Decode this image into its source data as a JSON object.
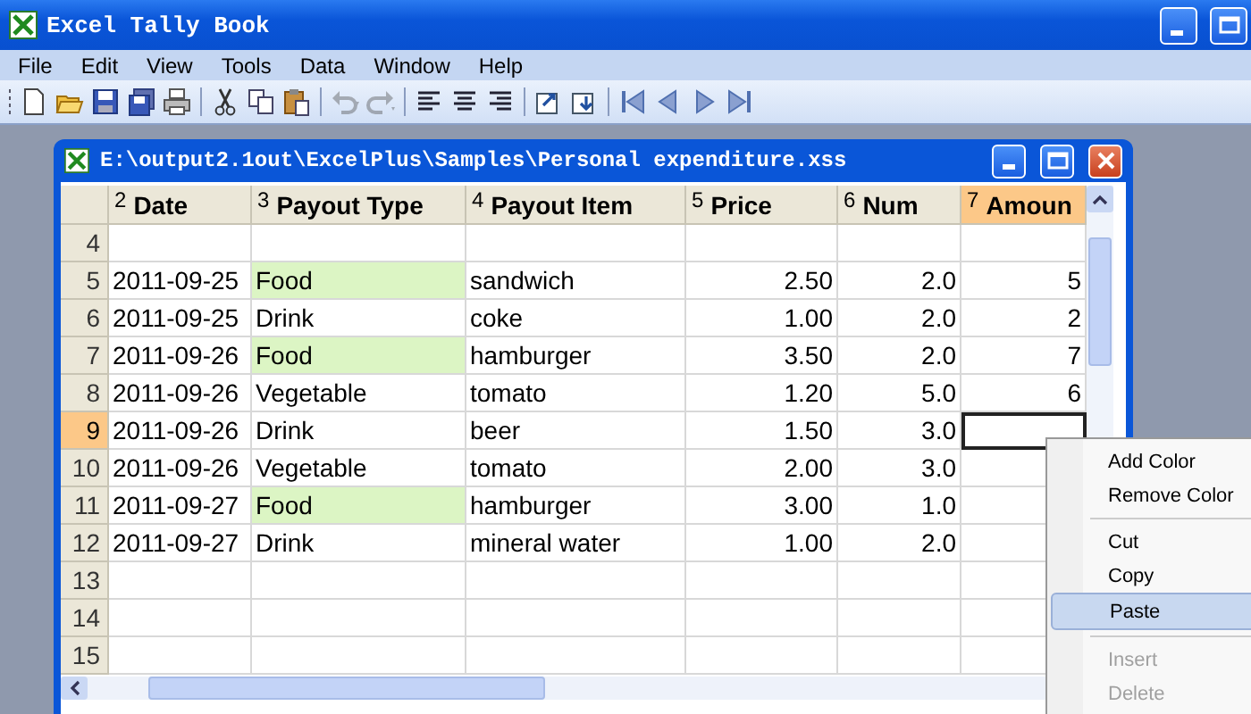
{
  "app": {
    "title": "Excel Tally Book"
  },
  "menu": [
    "File",
    "Edit",
    "View",
    "Tools",
    "Data",
    "Window",
    "Help"
  ],
  "toolbar": [
    {
      "kind": "new",
      "disabled": false
    },
    {
      "kind": "open",
      "disabled": false
    },
    {
      "kind": "save",
      "disabled": false
    },
    {
      "kind": "saveall",
      "disabled": false
    },
    {
      "kind": "print",
      "disabled": false
    },
    {
      "kind": "separator",
      "disabled": false
    },
    {
      "kind": "cut",
      "disabled": false
    },
    {
      "kind": "copy",
      "disabled": false
    },
    {
      "kind": "paste",
      "disabled": false
    },
    {
      "kind": "separator",
      "disabled": false
    },
    {
      "kind": "undo",
      "disabled": true
    },
    {
      "kind": "redo",
      "disabled": true
    },
    {
      "kind": "separator",
      "disabled": false
    },
    {
      "kind": "alignleft",
      "disabled": false
    },
    {
      "kind": "aligncenter",
      "disabled": false
    },
    {
      "kind": "alignright",
      "disabled": false
    },
    {
      "kind": "separator",
      "disabled": false
    },
    {
      "kind": "export",
      "disabled": false
    },
    {
      "kind": "import",
      "disabled": false
    },
    {
      "kind": "separator",
      "disabled": false
    },
    {
      "kind": "first",
      "disabled": false
    },
    {
      "kind": "prev",
      "disabled": false
    },
    {
      "kind": "next",
      "disabled": false
    },
    {
      "kind": "last",
      "disabled": false
    }
  ],
  "document": {
    "title": "E:\\output2.1out\\ExcelPlus\\Samples\\Personal expenditure.xss",
    "columns": [
      {
        "number": "2",
        "label": "Date",
        "selected": false
      },
      {
        "number": "3",
        "label": "Payout Type",
        "selected": false
      },
      {
        "number": "4",
        "label": "Payout Item",
        "selected": false
      },
      {
        "number": "5",
        "label": "Price",
        "selected": false
      },
      {
        "number": "6",
        "label": "Num",
        "selected": false
      },
      {
        "number": "7",
        "label": "Amoun",
        "selected": true
      }
    ],
    "rows": [
      {
        "number": "4",
        "selected": false,
        "highlighted": false,
        "cells": {}
      },
      {
        "number": "5",
        "selected": false,
        "highlighted": true,
        "cells": {
          "date": "2011-09-25",
          "type": "Food",
          "item": "sandwich",
          "price": "2.50",
          "num": "2.0",
          "amount": "5"
        }
      },
      {
        "number": "6",
        "selected": false,
        "highlighted": false,
        "cells": {
          "date": "2011-09-25",
          "type": "Drink",
          "item": "coke",
          "price": "1.00",
          "num": "2.0",
          "amount": "2"
        }
      },
      {
        "number": "7",
        "selected": false,
        "highlighted": true,
        "cells": {
          "date": "2011-09-26",
          "type": "Food",
          "item": "hamburger",
          "price": "3.50",
          "num": "2.0",
          "amount": "7"
        }
      },
      {
        "number": "8",
        "selected": false,
        "highlighted": false,
        "cells": {
          "date": "2011-09-26",
          "type": "Vegetable",
          "item": "tomato",
          "price": "1.20",
          "num": "5.0",
          "amount": "6"
        }
      },
      {
        "number": "9",
        "selected": true,
        "highlighted": false,
        "cells": {
          "date": "2011-09-26",
          "type": "Drink",
          "item": "beer",
          "price": "1.50",
          "num": "3.0"
        }
      },
      {
        "number": "10",
        "selected": false,
        "highlighted": false,
        "cells": {
          "date": "2011-09-26",
          "type": "Vegetable",
          "item": "tomato",
          "price": "2.00",
          "num": "3.0"
        }
      },
      {
        "number": "11",
        "selected": false,
        "highlighted": true,
        "cells": {
          "date": "2011-09-27",
          "type": "Food",
          "item": "hamburger",
          "price": "3.00",
          "num": "1.0"
        }
      },
      {
        "number": "12",
        "selected": false,
        "highlighted": false,
        "cells": {
          "date": "2011-09-27",
          "type": "Drink",
          "item": "mineral water",
          "price": "1.00",
          "num": "2.0"
        }
      },
      {
        "number": "13",
        "selected": false,
        "highlighted": false,
        "cells": {}
      },
      {
        "number": "14",
        "selected": false,
        "highlighted": false,
        "cells": {}
      },
      {
        "number": "15",
        "selected": false,
        "highlighted": false,
        "cells": {}
      }
    ]
  },
  "context_menu": [
    {
      "kind": "item",
      "label": "Add Color",
      "disabled": false,
      "selected": false
    },
    {
      "kind": "item",
      "label": "Remove Color",
      "disabled": false,
      "selected": false
    },
    {
      "kind": "separator"
    },
    {
      "kind": "item",
      "label": "Cut",
      "disabled": false,
      "selected": false
    },
    {
      "kind": "item",
      "label": "Copy",
      "disabled": false,
      "selected": false
    },
    {
      "kind": "item",
      "label": "Paste",
      "disabled": false,
      "selected": true
    },
    {
      "kind": "separator"
    },
    {
      "kind": "item",
      "label": "Insert",
      "disabled": true,
      "selected": false
    },
    {
      "kind": "item",
      "label": "Delete",
      "disabled": true,
      "selected": false
    }
  ]
}
